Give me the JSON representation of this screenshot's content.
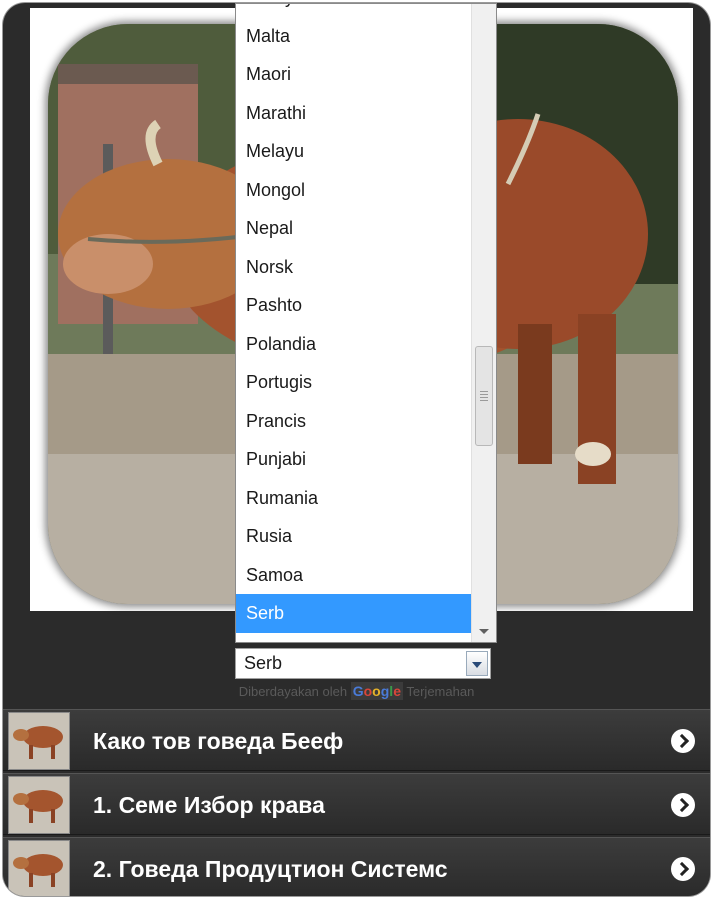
{
  "language_dropdown": {
    "options": [
      "Malayalam",
      "Malta",
      "Maori",
      "Marathi",
      "Melayu",
      "Mongol",
      "Nepal",
      "Norsk",
      "Pashto",
      "Polandia",
      "Portugis",
      "Prancis",
      "Punjabi",
      "Rumania",
      "Rusia",
      "Samoa",
      "Serb"
    ],
    "selected": "Serb"
  },
  "select": {
    "value": "Serb"
  },
  "powered_by": {
    "prefix": "Diberdayakan oleh",
    "brand": [
      "G",
      "o",
      "o",
      "g",
      "l",
      "e"
    ],
    "suffix": "Terjemahan"
  },
  "menu": [
    {
      "label": "Како тов говеда Бееф"
    },
    {
      "label": "1. Семе Избор крава"
    },
    {
      "label": "2. Говеда Продуцтион Системс"
    }
  ],
  "colors": {
    "selected_bg": "#3399ff",
    "menu_bg": "#2b2b2b"
  },
  "icons": [
    "chevron-right-icon",
    "cow-thumbnail",
    "scroll-down-icon",
    "dropdown-arrow-icon"
  ]
}
